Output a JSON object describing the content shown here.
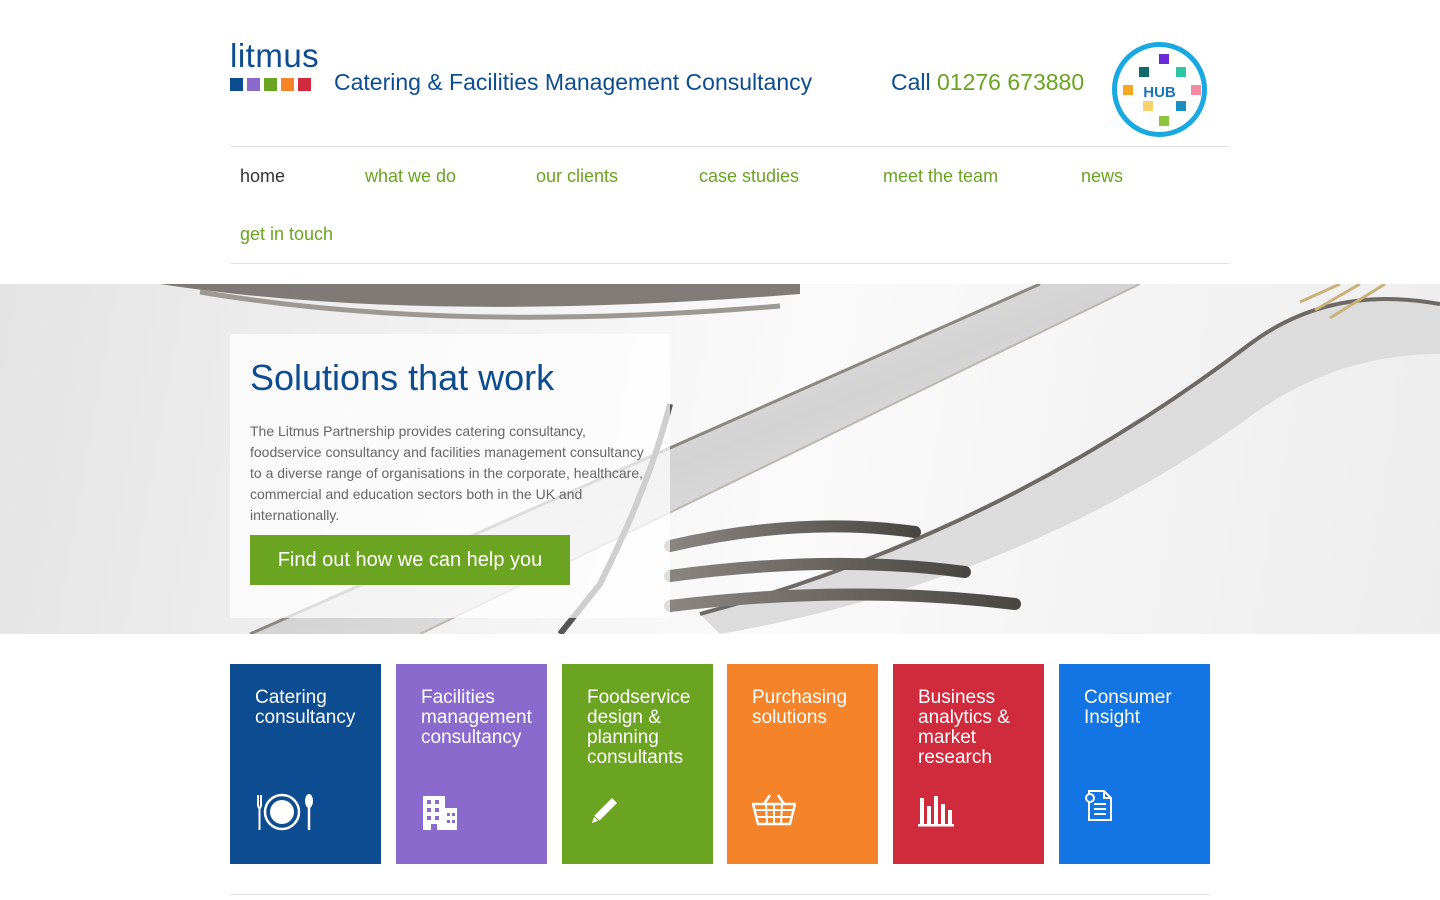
{
  "brand": {
    "logo_text": "litmus",
    "logo_squares": [
      "#0d4c91",
      "#8a6bcd",
      "#6aa421",
      "#f5832a",
      "#cf2b3d"
    ],
    "tagline": "Catering & Facilities Management Consultancy",
    "call_label": "Call",
    "phone": "01276 673880",
    "hub_label": "HUB"
  },
  "nav": {
    "items": [
      {
        "label": "home",
        "active": true
      },
      {
        "label": "what we do"
      },
      {
        "label": "our clients"
      },
      {
        "label": "case studies"
      },
      {
        "label": "meet the team"
      },
      {
        "label": "news"
      },
      {
        "label": "get in touch"
      }
    ]
  },
  "hero": {
    "title": "Solutions that work",
    "text": "The Litmus Partnership provides catering consultancy, foodservice consultancy and facilities management consultancy to a diverse range of organisations in the corporate, healthcare, commercial and education sectors both in the UK and internationally.",
    "cta_label": "Find out how we can help you"
  },
  "tiles": [
    {
      "title": "Catering consultancy",
      "color": "#0d4c91",
      "icon": "plate-cutlery-icon"
    },
    {
      "title": "Facilities management consultancy",
      "color": "#8a6bcd",
      "icon": "building-icon"
    },
    {
      "title": "Foodservice design & planning consultants",
      "color": "#6aa421",
      "icon": "pencil-icon"
    },
    {
      "title": "Purchasing solutions",
      "color": "#f5832a",
      "icon": "basket-icon"
    },
    {
      "title": "Business analytics & market research",
      "color": "#cf2b3d",
      "icon": "bar-chart-icon"
    },
    {
      "title": "Consumer Insight",
      "color": "#1374e3",
      "icon": "document-icon"
    }
  ],
  "colors": {
    "brand_blue": "#0d4c91",
    "accent_green": "#6aa421",
    "hub_ring": "#19a9e0"
  }
}
